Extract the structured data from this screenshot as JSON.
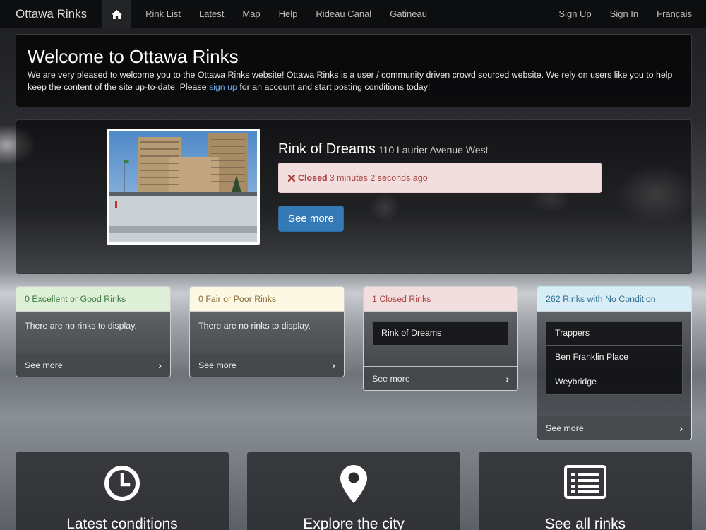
{
  "navbar": {
    "brand": "Ottawa Rinks",
    "home_icon": "home-icon",
    "links": [
      "Rink List",
      "Latest",
      "Map",
      "Help",
      "Rideau Canal",
      "Gatineau"
    ],
    "right_links": [
      "Sign Up",
      "Sign In",
      "Français"
    ]
  },
  "welcome": {
    "title": "Welcome to Ottawa Rinks",
    "text_before": "We are very pleased to welcome you to the Ottawa Rinks website! Ottawa Rinks is a user / community driven crowd sourced website. We rely on users like you to help keep the content of the site up-to-date. Please ",
    "link": "sign up",
    "text_after": " for an account and start posting conditions today!"
  },
  "featured": {
    "name": "Rink of Dreams",
    "address": "110 Laurier Avenue West",
    "status_icon": "x-icon",
    "status": "Closed",
    "time": "3 minutes 2 seconds ago",
    "button": "See more"
  },
  "panels": [
    {
      "heading": "0 Excellent or Good Rinks",
      "empty": "There are no rinks to display.",
      "items": [],
      "footer": "See more",
      "color": "#dff0d8",
      "text_color": "#3c763d"
    },
    {
      "heading": "0 Fair or Poor Rinks",
      "empty": "There are no rinks to display.",
      "items": [],
      "footer": "See more",
      "color": "#fcf8e3",
      "text_color": "#8a6d3b"
    },
    {
      "heading": "1 Closed Rinks",
      "empty": "",
      "items": [
        "Rink of Dreams"
      ],
      "footer": "See more",
      "color": "#f2dede",
      "text_color": "#a94442"
    },
    {
      "heading": "262 Rinks with No Condition",
      "empty": "",
      "items": [
        "Trappers",
        "Ben Franklin Place",
        "Weybridge"
      ],
      "footer": "See more",
      "color": "#d9edf7",
      "text_color": "#31708f"
    }
  ],
  "tiles": [
    {
      "label": "Latest conditions",
      "icon": "clock-icon"
    },
    {
      "label": "Explore the city",
      "icon": "map-marker-icon"
    },
    {
      "label": "See all rinks",
      "icon": "list-icon"
    }
  ]
}
